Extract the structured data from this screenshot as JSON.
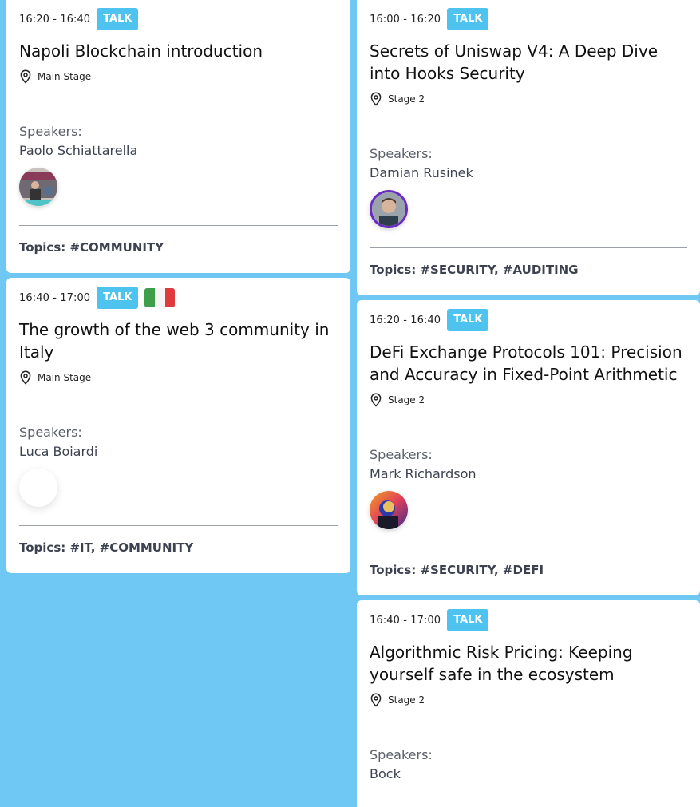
{
  "colors": {
    "background": "#6ec8f3",
    "card": "#ffffff",
    "badge": "#4fc3f0"
  },
  "sessions": [
    {
      "time": "16:20 - 16:40",
      "badge": "TALK",
      "title": "Napoli Blockchain introduction",
      "location": "Main Stage",
      "speakers_label": "Speakers:",
      "speaker": "Paolo Schiattarella",
      "topics": "Topics: #COMMUNITY",
      "location_icon": "map-pin-icon",
      "avatar": "speaker-photo"
    },
    {
      "time": "16:40 - 17:00",
      "badge": "TALK",
      "flag": "italy-flag",
      "title": "The growth of the web 3 community in Italy",
      "location": "Main Stage",
      "speakers_label": "Speakers:",
      "speaker": "Luca Boiardi",
      "topics": "Topics: #IT, #COMMUNITY",
      "location_icon": "map-pin-icon",
      "avatar": "blank-avatar"
    },
    {
      "time": "16:00 - 16:20",
      "badge": "TALK",
      "title": "Secrets of Uniswap V4: A Deep Dive into Hooks Security",
      "location": "Stage 2",
      "speakers_label": "Speakers:",
      "speaker": "Damian Rusinek",
      "topics": "Topics: #SECURITY, #AUDITING",
      "location_icon": "map-pin-icon",
      "avatar": "speaker-photo"
    },
    {
      "time": "16:20 - 16:40",
      "badge": "TALK",
      "title": "DeFi Exchange Protocols 101: Precision and Accuracy in Fixed-Point Arithmetic",
      "location": "Stage 2",
      "speakers_label": "Speakers:",
      "speaker": "Mark Richardson",
      "topics": "Topics: #SECURITY, #DEFI",
      "location_icon": "map-pin-icon",
      "avatar": "speaker-photo"
    },
    {
      "time": "16:40 - 17:00",
      "badge": "TALK",
      "title": "Algorithmic Risk Pricing: Keeping yourself safe in the ecosystem",
      "location": "Stage 2",
      "speakers_label": "Speakers:",
      "speaker": "Bock",
      "location_icon": "map-pin-icon"
    }
  ]
}
